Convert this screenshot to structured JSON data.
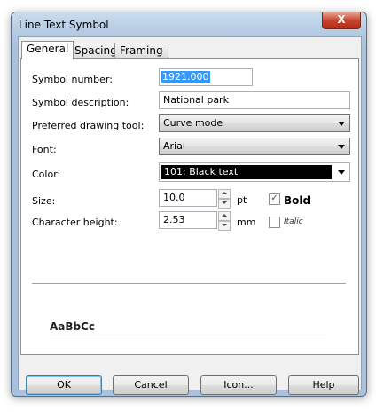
{
  "window": {
    "title": "Line Text Symbol",
    "close_label": "X"
  },
  "tabs": [
    {
      "label": "General",
      "active": true
    },
    {
      "label": "Spacing",
      "active": false
    },
    {
      "label": "Framing",
      "active": false
    }
  ],
  "form": {
    "symbol_number_label": "Symbol number:",
    "symbol_number_value": "1921.000",
    "symbol_description_label": "Symbol description:",
    "symbol_description_value": "National park",
    "drawing_tool_label": "Preferred drawing tool:",
    "drawing_tool_value": "Curve mode",
    "font_label": "Font:",
    "font_value": "Arial",
    "color_label": "Color:",
    "color_value": "101: Black text",
    "size_label": "Size:",
    "size_value": "10.0",
    "size_unit": "pt",
    "bold_label": "Bold",
    "bold_checked": true,
    "char_height_label": "Character height:",
    "char_height_value": "2.53",
    "char_height_unit": "mm",
    "italic_label": "Italic",
    "italic_checked": false
  },
  "preview": {
    "sample_text": "AaBbCc",
    "line_color": "#c00000"
  },
  "buttons": {
    "ok": "OK",
    "cancel": "Cancel",
    "icon": "Icon...",
    "help": "Help"
  }
}
